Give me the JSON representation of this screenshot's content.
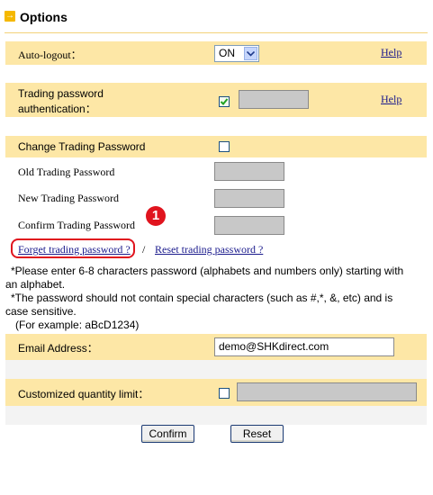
{
  "header": {
    "title": "Options",
    "arrow_glyph": "→"
  },
  "auto_logout": {
    "label": "Auto-logout：",
    "value": "ON",
    "help": "Help"
  },
  "trading_pw_auth": {
    "label_line1": "Trading password",
    "label_line2": "authentication：",
    "checked": true,
    "help": "Help"
  },
  "change_pw": {
    "label": "Change Trading Password",
    "checked": false
  },
  "old_pw": {
    "label": "Old Trading Password"
  },
  "new_pw": {
    "label": "New Trading Password"
  },
  "confirm_pw": {
    "label": "Confirm Trading Password"
  },
  "links": {
    "forget": "Forget trading password ?",
    "separator": "/",
    "reset": "Reset trading password ?"
  },
  "callout": {
    "number": "1"
  },
  "notes": {
    "line1": "*Please enter 6-8 characters password (alphabets and numbers only) starting with",
    "line2": "an alphabet.",
    "line3": "*The password should not contain special characters (such as #,*, &, etc) and is",
    "line4": "case sensitive.",
    "line5": "(For example: aBcD1234)"
  },
  "email": {
    "label": "Email Address：",
    "value": "demo@SHKdirect.com"
  },
  "qty_limit": {
    "label": "Customized quantity limit：",
    "checked": false
  },
  "buttons": {
    "confirm": "Confirm",
    "reset": "Reset"
  },
  "colors": {
    "band": "#fde7a6",
    "link": "#1a1a8c",
    "callout": "#e0141e"
  }
}
